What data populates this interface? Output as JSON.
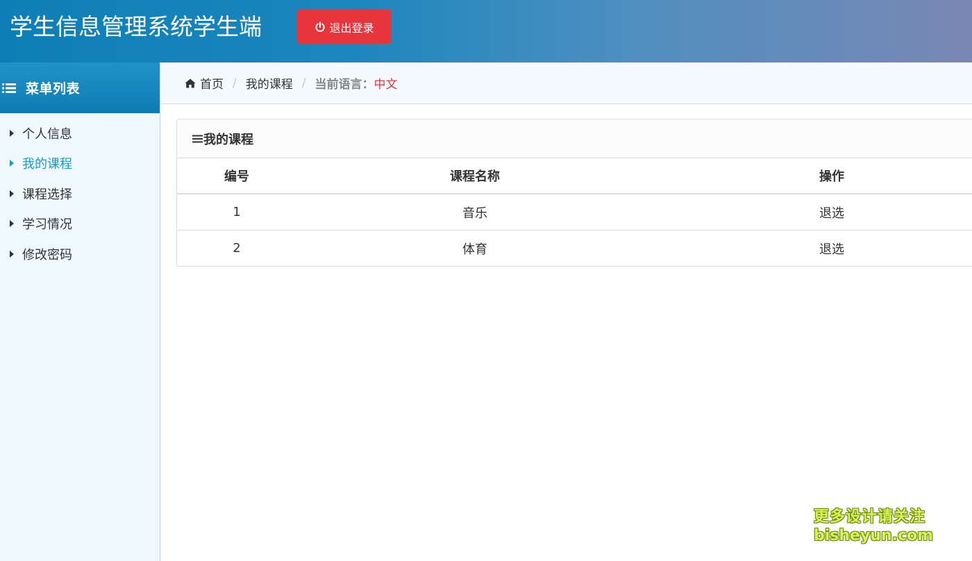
{
  "header": {
    "title": "学生信息管理系统学生端",
    "logout_label": "退出登录",
    "logout_icon": "power-icon",
    "gradient_start": "#0e7fb6",
    "gradient_end": "#7a87b4",
    "logout_color": "#e8353b"
  },
  "sidebar": {
    "title": "菜单列表",
    "title_icon": "list-icon",
    "items": [
      {
        "label": "个人信息",
        "active": false
      },
      {
        "label": "我的课程",
        "active": true
      },
      {
        "label": "课程选择",
        "active": false
      },
      {
        "label": "学习情况",
        "active": false
      },
      {
        "label": "修改密码",
        "active": false
      }
    ],
    "active_color": "#1a9bc7"
  },
  "breadcrumb": {
    "home_icon": "home-icon",
    "home": "首页",
    "page": "我的课程",
    "lang_label": "当前语言：",
    "lang_value": "中文"
  },
  "panel": {
    "title": "我的课程",
    "title_icon": "menu-icon",
    "columns": [
      "编号",
      "课程名称",
      "操作"
    ],
    "rows": [
      {
        "id": "1",
        "name": "音乐",
        "action": "退选"
      },
      {
        "id": "2",
        "name": "体育",
        "action": "退选"
      }
    ]
  },
  "watermark": {
    "line1": "更多设计请关注",
    "line2": "bisheyun.com"
  }
}
